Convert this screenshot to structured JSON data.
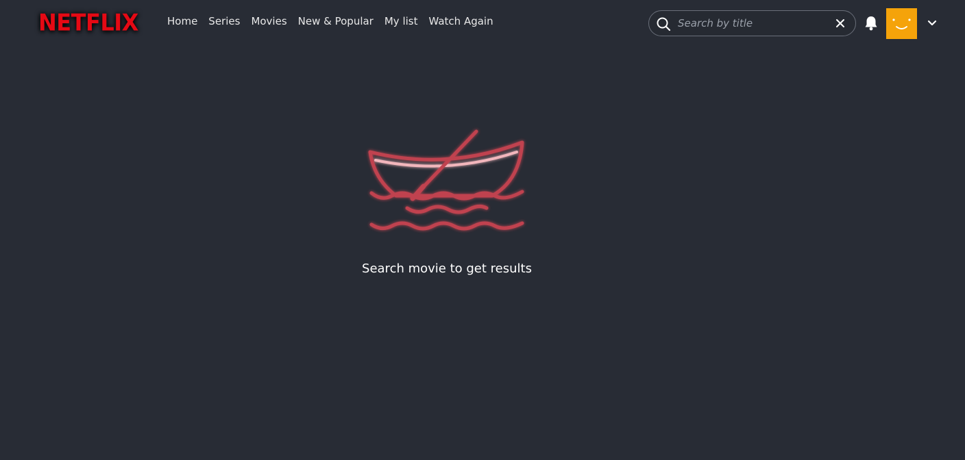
{
  "header": {
    "logo_text": "NETFLIX",
    "nav": [
      {
        "label": "Home"
      },
      {
        "label": "Series"
      },
      {
        "label": "Movies"
      },
      {
        "label": "New & Popular"
      },
      {
        "label": "My list"
      },
      {
        "label": "Watch Again"
      }
    ],
    "search": {
      "placeholder": "Search by title",
      "value": "",
      "icon": "search-icon",
      "clear_icon": "close-icon"
    },
    "notifications_icon": "bell-icon",
    "profile_menu_icon": "chevron-down-icon"
  },
  "main": {
    "empty_state_icon": "rowboat-icon",
    "empty_state_text": "Search movie to get results"
  },
  "colors": {
    "background": "#282c35",
    "brand": "#e50914",
    "avatar": "#f5a30a",
    "illustration": "#c0434f"
  }
}
